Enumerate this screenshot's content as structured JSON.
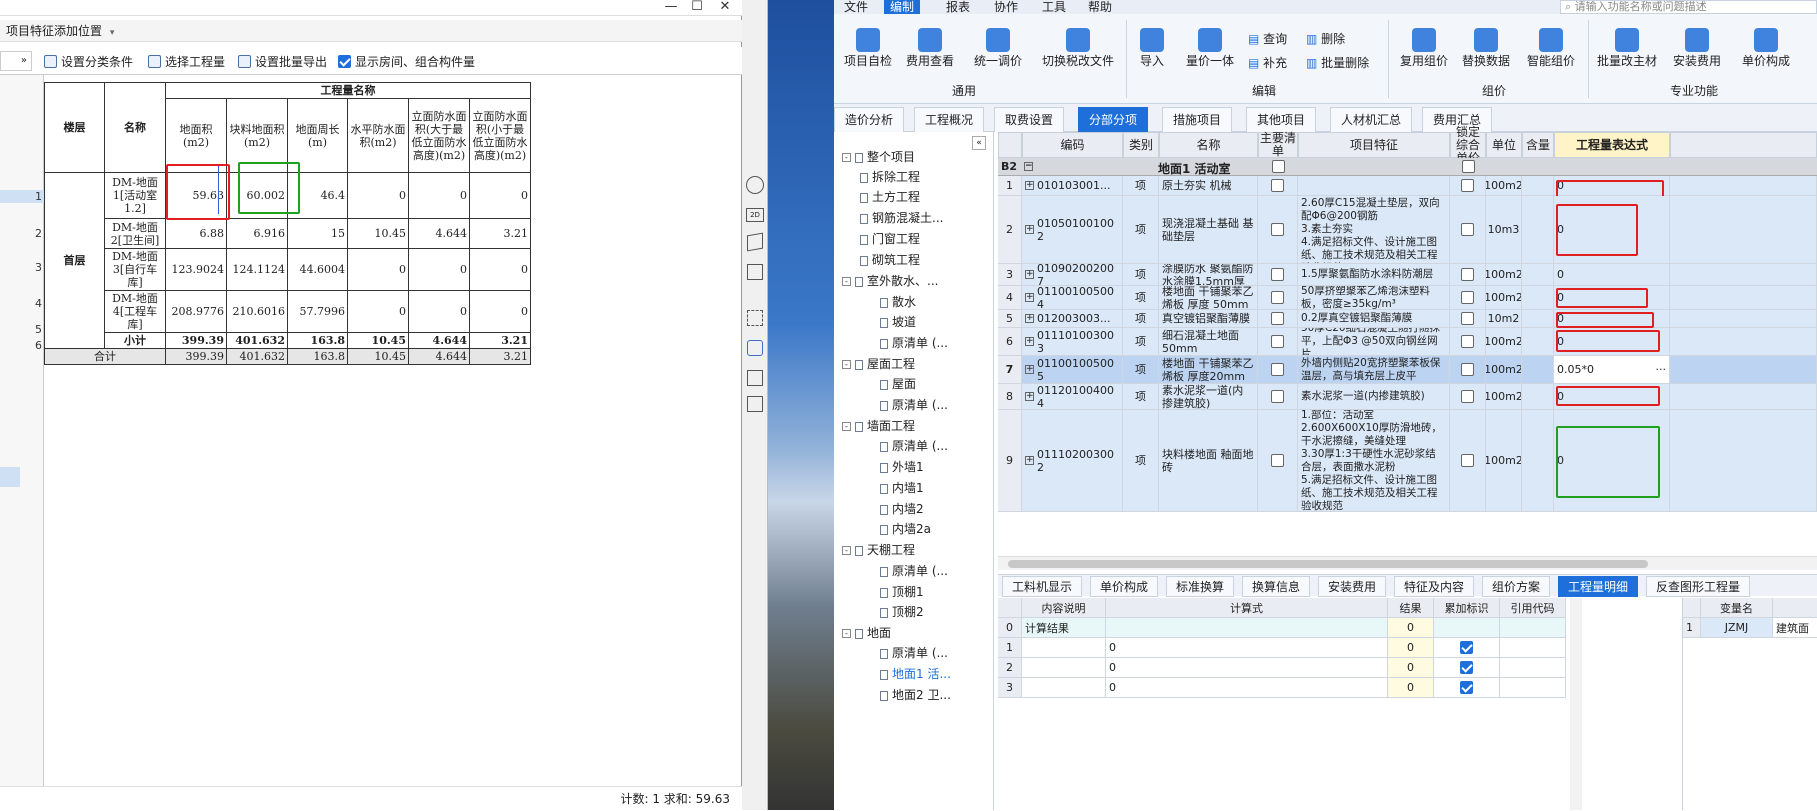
{
  "left": {
    "header_text": "项目特征添加位置",
    "toolbar": {
      "classify": "设置分类条件",
      "select_qty": "选择工程量",
      "batch_export": "设置批量导出",
      "show_rooms": "显示房间、组合构件量"
    },
    "table": {
      "group_header": "工程量名称",
      "col_floor": "楼层",
      "col_name": "名称",
      "cols": [
        "地面积(m2)",
        "块料地面积(m2)",
        "地面周长(m)",
        "水平防水面积(m2)",
        "立面防水面积(大于最低立面防水高度)(m2)",
        "立面防水面积(小于最低立面防水高度)(m2)"
      ],
      "floor": "首层",
      "rows": [
        {
          "name": "DM-地面1[活动室1.2]",
          "v": [
            "59.63",
            "60.002",
            "46.4",
            "0",
            "0",
            "0"
          ]
        },
        {
          "name": "DM-地面2[卫生间]",
          "v": [
            "6.88",
            "6.916",
            "15",
            "10.45",
            "4.644",
            "3.21"
          ]
        },
        {
          "name": "DM-地面3[自行车库]",
          "v": [
            "123.9024",
            "124.1124",
            "44.6004",
            "0",
            "0",
            "0"
          ]
        },
        {
          "name": "DM-地面4[工程车库]",
          "v": [
            "208.9776",
            "210.6016",
            "57.7996",
            "0",
            "0",
            "0"
          ]
        }
      ],
      "subtotal_label": "小计",
      "subtotal": [
        "399.39",
        "401.632",
        "163.8",
        "10.45",
        "4.644",
        "3.21"
      ],
      "total_label": "合计",
      "total": [
        "399.39",
        "401.632",
        "163.8",
        "10.45",
        "4.644",
        "3.21"
      ],
      "row_numbers": [
        "1",
        "2",
        "3",
        "4",
        "5",
        "6"
      ]
    },
    "status": "计数: 1   求和: 59.63"
  },
  "right": {
    "menus": [
      "文件",
      "编制",
      "报表",
      "协作",
      "工具",
      "帮助"
    ],
    "search_placeholder": "请输入功能名称或问题描述",
    "ribbon": {
      "buttons": [
        "项目自检",
        "费用查看",
        "统一调价",
        "切换税改文件",
        "导入",
        "量价一体",
        "查询",
        "补充",
        "删除",
        "批量删除",
        "复用组价",
        "替换数据",
        "智能组价",
        "批量改主材",
        "安装费用",
        "单价构成"
      ],
      "groups": [
        "通用",
        "编辑",
        "组价",
        "专业功能"
      ]
    },
    "tabs": [
      "造价分析",
      "工程概况",
      "取费设置",
      "分部分项",
      "措施项目",
      "其他项目",
      "人材机汇总",
      "费用汇总"
    ],
    "tree": [
      {
        "label": "整个项目",
        "level": 0,
        "box": "-"
      },
      {
        "label": "拆除工程",
        "level": 1
      },
      {
        "label": "土方工程",
        "level": 1
      },
      {
        "label": "钢筋混凝土...",
        "level": 1
      },
      {
        "label": "门窗工程",
        "level": 1
      },
      {
        "label": "砌筑工程",
        "level": 1
      },
      {
        "label": "室外散水、...",
        "level": 1,
        "box": "-"
      },
      {
        "label": "散水",
        "level": 2
      },
      {
        "label": "坡道",
        "level": 2
      },
      {
        "label": "原清单 (...",
        "level": 2
      },
      {
        "label": "屋面工程",
        "level": 1,
        "box": "-"
      },
      {
        "label": "屋面",
        "level": 2
      },
      {
        "label": "原清单 (...",
        "level": 2
      },
      {
        "label": "墙面工程",
        "level": 1,
        "box": "-"
      },
      {
        "label": "原清单 (...",
        "level": 2
      },
      {
        "label": "外墙1",
        "level": 2
      },
      {
        "label": "内墙1",
        "level": 2
      },
      {
        "label": "内墙2",
        "level": 2
      },
      {
        "label": "内墙2a",
        "level": 2
      },
      {
        "label": "天棚工程",
        "level": 1,
        "box": "-"
      },
      {
        "label": "原清单 (...",
        "level": 2
      },
      {
        "label": "顶棚1",
        "level": 2
      },
      {
        "label": "顶棚2",
        "level": 2
      },
      {
        "label": "地面",
        "level": 1,
        "box": "-"
      },
      {
        "label": "原清单 (...",
        "level": 2
      },
      {
        "label": "地面1 活...",
        "level": 2,
        "active": true
      },
      {
        "label": "地面2 卫...",
        "level": 2
      }
    ],
    "grid": {
      "headers": [
        "编码",
        "类别",
        "名称",
        "主要清单",
        "项目特征",
        "锁定综合单价",
        "单位",
        "含量",
        "工程量表达式"
      ],
      "b2": {
        "tag": "B2",
        "name": "地面1 活动室"
      },
      "rows": [
        {
          "no": "1",
          "code": "010103001...",
          "cat": "项",
          "name": "原土夯实 机械",
          "feat": "",
          "unit": "100m2",
          "expr": "0"
        },
        {
          "no": "2",
          "code": "010501001002",
          "cat": "项",
          "name": "现浇混凝土基础 基础垫层",
          "feat": "1.部位：活动室\n2.60厚C15混凝土垫层，双向配Φ6@200钢筋\n3.素土夯实\n4.满足招标文件、设计施工图纸、施工技术规范及相关工程验收规范",
          "unit": "10m3",
          "expr": "0"
        },
        {
          "no": "3",
          "code": "010902002007",
          "cat": "项",
          "name": "涂膜防水 聚氨酯防水涂膜1.5mm厚",
          "feat": "1.5厚聚氨酯防水涂料防潮层",
          "unit": "100m2",
          "expr": "0"
        },
        {
          "no": "4",
          "code": "011001005004",
          "cat": "项",
          "name": "楼地面 干铺聚苯乙烯板 厚度 50mm",
          "feat": "50厚挤塑聚苯乙烯泡沫塑料板，密度≥35kg/m³",
          "unit": "100m2",
          "expr": "0"
        },
        {
          "no": "5",
          "code": "012003003...",
          "cat": "项",
          "name": "真空镀铝聚酯薄膜",
          "feat": "0.2厚真空镀铝聚酯薄膜",
          "unit": "10m2",
          "expr": "0"
        },
        {
          "no": "6",
          "code": "011101003003",
          "cat": "项",
          "name": "细石混凝土地面 50mm",
          "feat": "50厚C20细石混凝土随打随抹平，上配Φ3 @50双向钢丝网片",
          "unit": "100m2",
          "expr": "0"
        },
        {
          "no": "7",
          "code": "011001005005",
          "cat": "项",
          "name": "楼地面 干铺聚苯乙烯板 厚度20mm",
          "feat": "外墙内侧贴20宽挤塑聚苯板保温层，高与填充层上皮平",
          "unit": "100m2",
          "expr": "0.05*0"
        },
        {
          "no": "8",
          "code": "011201004004",
          "cat": "项",
          "name": "素水泥浆一道(内掺建筑胶)",
          "feat": "素水泥浆一道(内掺建筑胶)",
          "unit": "100m2",
          "expr": "0"
        },
        {
          "no": "9",
          "code": "011102003002",
          "cat": "项",
          "name": "块料楼地面 釉面地砖",
          "feat": "1.部位：活动室\n2.600X600X10厚防滑地砖，干水泥擦缝，美缝处理\n3.30厚1:3干硬性水泥砂浆结合层，表面撒水泥粉\n5.满足招标文件、设计施工图纸、施工技术规范及相关工程验收规范",
          "unit": "100m2",
          "expr": "0"
        }
      ]
    },
    "bottom_tabs": [
      "工料机显示",
      "单价构成",
      "标准换算",
      "换算信息",
      "安装费用",
      "特征及内容",
      "组价方案",
      "工程量明细",
      "反查图形工程量"
    ],
    "detail": {
      "headers": [
        "内容说明",
        "计算式",
        "结果",
        "累加标识",
        "引用代码"
      ],
      "rows": [
        {
          "no": "0",
          "desc": "计算结果",
          "formula": "",
          "result": "0",
          "flag": false
        },
        {
          "no": "1",
          "desc": "",
          "formula": "0",
          "result": "0",
          "flag": true
        },
        {
          "no": "2",
          "desc": "",
          "formula": "0",
          "result": "0",
          "flag": true
        },
        {
          "no": "3",
          "desc": "",
          "formula": "0",
          "result": "0",
          "flag": true
        }
      ]
    },
    "var_table": {
      "header": "变量名",
      "row_no": "1",
      "name": "JZMJ",
      "desc": "建筑面"
    }
  }
}
